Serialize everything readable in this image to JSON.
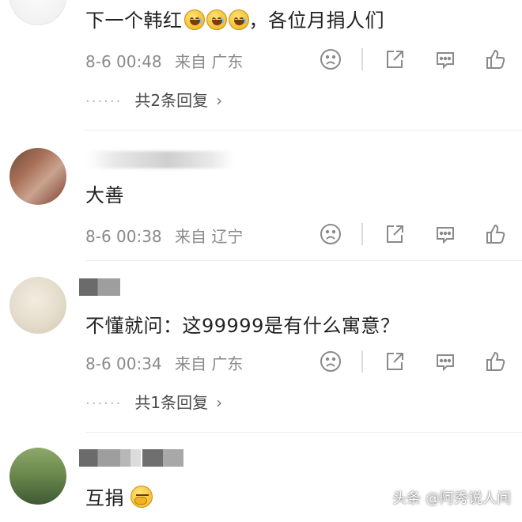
{
  "comments": [
    {
      "text": "下一个韩红",
      "text_suffix": "，各位月捐人们",
      "emoji_count": 3,
      "time": "8-6 00:48",
      "location_prefix": "来自",
      "location": "广东",
      "replies": "共2条回复"
    },
    {
      "text": "大善",
      "time": "8-6 00:38",
      "location_prefix": "来自",
      "location": "辽宁"
    },
    {
      "text": "不懂就问：这99999是有什么寓意？",
      "time": "8-6 00:34",
      "location_prefix": "来自",
      "location": "广东",
      "replies": "共1条回复"
    },
    {
      "text": "互捐"
    }
  ],
  "reply_dots": "······",
  "reply_chevron": "›",
  "icons": {
    "dislike": "frown-face-icon",
    "share": "share-icon",
    "comment": "comment-bubble-icon",
    "like": "thumbs-up-icon"
  },
  "watermark": "头条 @阿秀说人间"
}
